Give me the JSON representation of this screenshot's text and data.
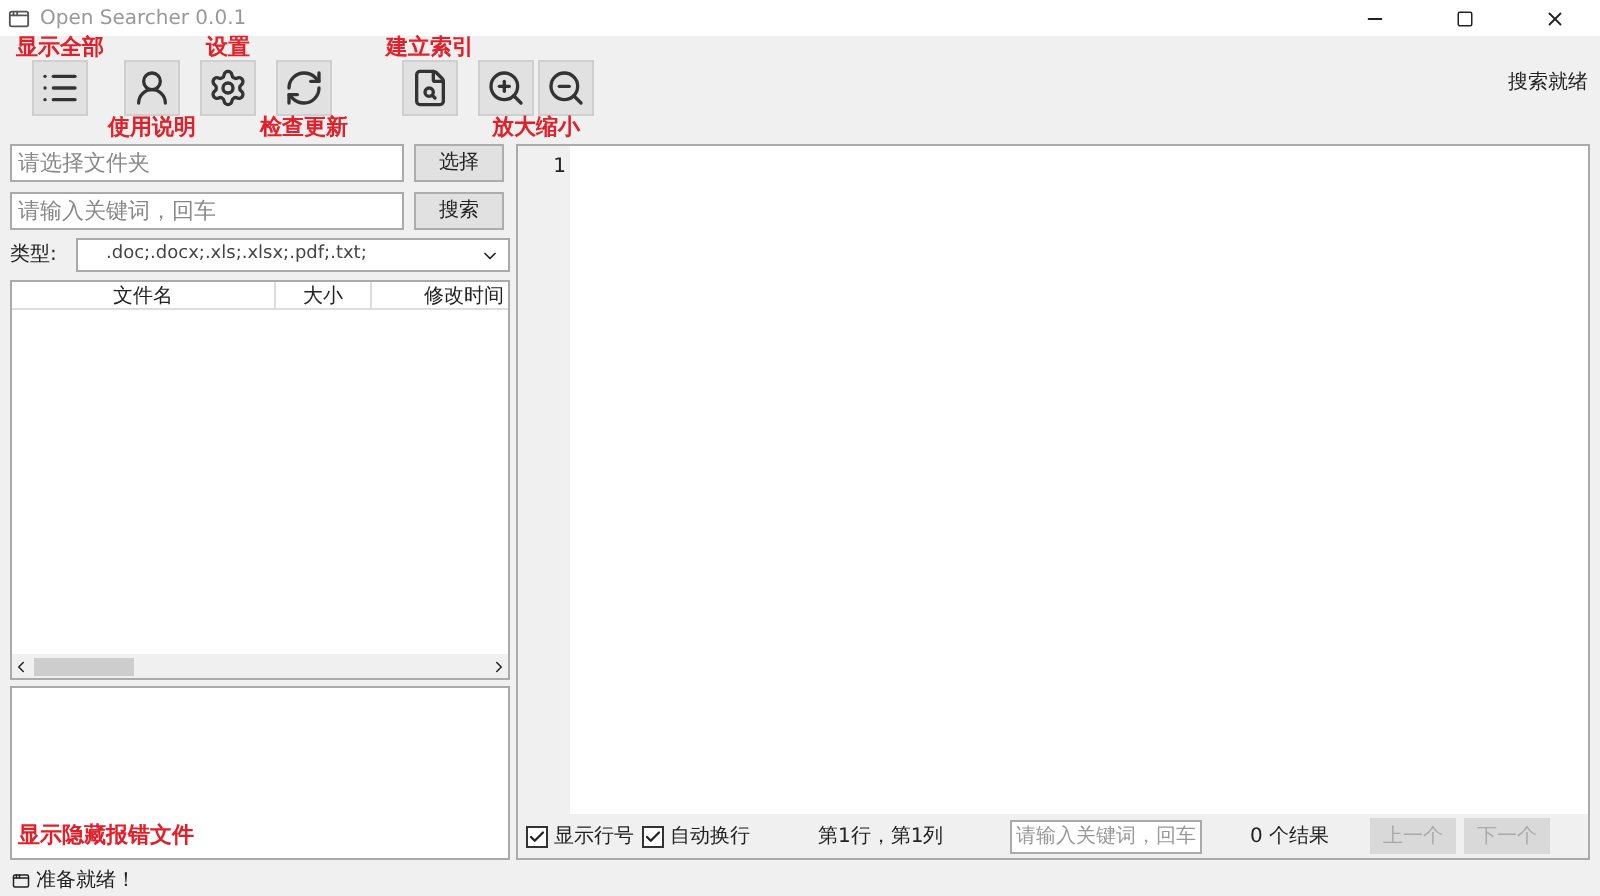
{
  "window": {
    "title": "Open Searcher 0.0.1"
  },
  "toolbar": [
    {
      "kind": "single",
      "annotation_above": "显示全部"
    },
    {
      "kind": "single",
      "annotation_below": "使用说明"
    },
    {
      "kind": "single",
      "annotation_above": "设置"
    },
    {
      "kind": "single",
      "annotation_below": "检查更新"
    },
    {
      "kind": "single",
      "annotation_above": "建立索引"
    },
    {
      "kind": "pair",
      "annotation_below": "放大缩小"
    }
  ],
  "search_status": "搜索就绪",
  "folder_field": {
    "placeholder": "请选择文件夹",
    "button": "选择"
  },
  "keyword_field": {
    "placeholder": "请输入关键词，回车",
    "button": "搜索"
  },
  "type_filter": {
    "label": "类型:",
    "value": ".doc;.docx;.xls;.xlsx;.pdf;.txt;"
  },
  "table": {
    "columns": [
      "文件名",
      "大小",
      "修改时间"
    ]
  },
  "error_files_link": "显示隐藏报错文件",
  "editor": {
    "line_numbers": [
      "1"
    ]
  },
  "options": [
    {
      "label": "显示行号",
      "checked": true
    },
    {
      "label": "自动换行",
      "checked": true
    }
  ],
  "cursor_position": "第1行，第1列",
  "find_field": {
    "placeholder": "请输入关键词，回车"
  },
  "result_count": "0 个结果",
  "nav_buttons": [
    {
      "label": "上一个",
      "disabled": true
    },
    {
      "label": "下一个",
      "disabled": true
    }
  ],
  "status_bar": "准备就绪！"
}
